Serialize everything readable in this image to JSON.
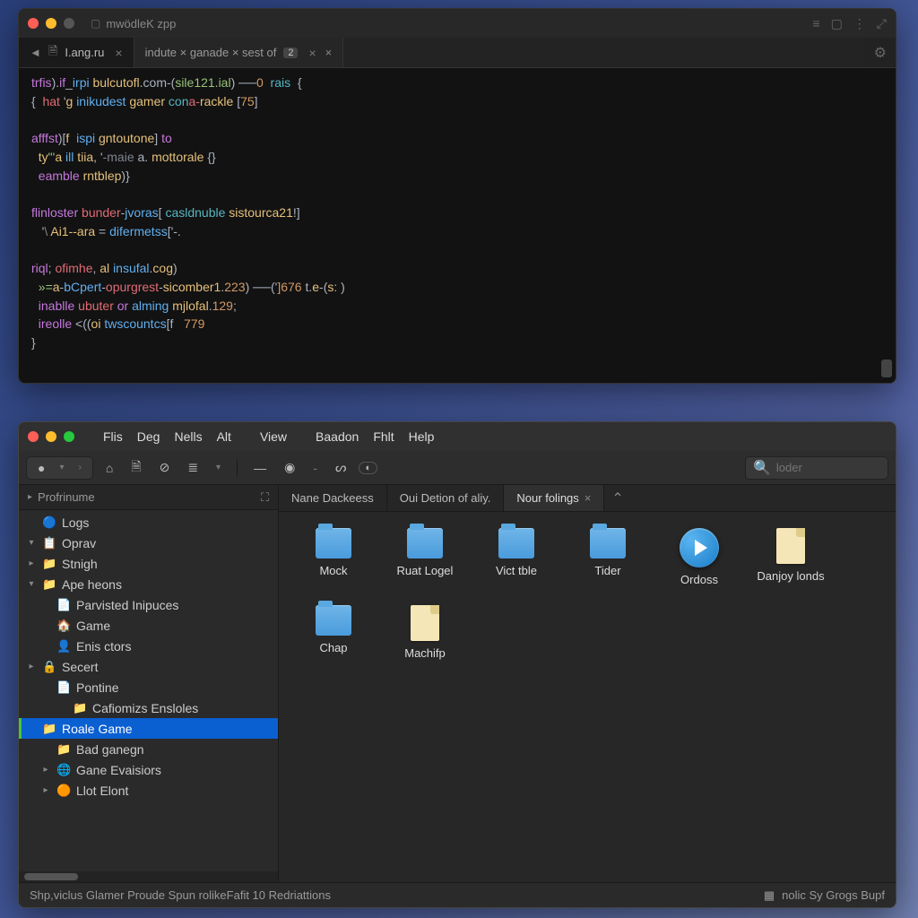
{
  "editor": {
    "title": "mwödleK zpp",
    "tabs": [
      {
        "label": "I.ang.ru",
        "active": true
      },
      {
        "label": "indute × ganade × sest of",
        "badge": "2",
        "closes": 2
      }
    ],
    "code": [
      [
        [
          "kw",
          "trfis"
        ],
        [
          "op",
          ")."
        ],
        [
          "kw",
          "if"
        ],
        [
          "op",
          "_"
        ],
        [
          "fn",
          "irpi"
        ],
        [
          "op",
          " "
        ],
        [
          "id",
          "bulcutofl"
        ],
        [
          "op",
          ".com-("
        ],
        [
          "str",
          "sile121.ial"
        ],
        [
          "op",
          ") ──"
        ],
        [
          "num",
          "0"
        ],
        [
          "op",
          "  "
        ],
        [
          "ty",
          "rais"
        ],
        [
          "op",
          "  {"
        ]
      ],
      [
        [
          "op",
          "{  "
        ],
        [
          "pr",
          "hat"
        ],
        [
          "op",
          " '"
        ],
        [
          "id",
          "g"
        ],
        [
          "op",
          " "
        ],
        [
          "fn",
          "inikudest"
        ],
        [
          "op",
          " "
        ],
        [
          "id",
          "gamer"
        ],
        [
          "op",
          " "
        ],
        [
          "ty",
          "con"
        ],
        [
          "pr",
          "a-"
        ],
        [
          "id",
          "rackle"
        ],
        [
          "op",
          " ["
        ],
        [
          "num",
          "75"
        ],
        [
          "op",
          "]"
        ]
      ],
      [],
      [
        [
          "kw",
          "afffst"
        ],
        [
          "op",
          ")["
        ],
        [
          "id",
          "f"
        ],
        [
          "op",
          "  "
        ],
        [
          "fn",
          "ispi"
        ],
        [
          "op",
          " "
        ],
        [
          "id",
          "gntoutone"
        ],
        [
          "op",
          "] "
        ],
        [
          "kw",
          "to"
        ]
      ],
      [
        [
          "op",
          "  "
        ],
        [
          "id",
          "ty"
        ],
        [
          "str",
          "\"'"
        ],
        [
          "id",
          "a"
        ],
        [
          "op",
          " "
        ],
        [
          "fn",
          "ill"
        ],
        [
          "op",
          " "
        ],
        [
          "id",
          "tiia"
        ],
        [
          "op",
          ", '"
        ],
        [
          "cm",
          "-maie"
        ],
        [
          "op",
          " a. "
        ],
        [
          "id",
          "mottorale"
        ],
        [
          "op",
          " {}"
        ]
      ],
      [
        [
          "op",
          "  "
        ],
        [
          "kw",
          "eamble"
        ],
        [
          "op",
          " "
        ],
        [
          "id",
          "rntblep"
        ],
        [
          "op",
          ")}"
        ]
      ],
      [],
      [
        [
          "kw",
          "flinloster"
        ],
        [
          "op",
          " "
        ],
        [
          "pr",
          "bunder"
        ],
        [
          "op",
          "-"
        ],
        [
          "fn",
          "jvoras"
        ],
        [
          "op",
          "[ "
        ],
        [
          "ty",
          "casldnuble"
        ],
        [
          "op",
          " "
        ],
        [
          "id",
          "sistourca21"
        ],
        [
          "op",
          "!]"
        ]
      ],
      [
        [
          "op",
          "   '"
        ],
        [
          "cm",
          "\\ "
        ],
        [
          "id",
          "Ai1--ara"
        ],
        [
          "op",
          " = "
        ],
        [
          "fn",
          "difermetss"
        ],
        [
          "op",
          "['-."
        ]
      ],
      [],
      [
        [
          "kw",
          "riql"
        ],
        [
          "op",
          "; "
        ],
        [
          "pr",
          "ofimhe"
        ],
        [
          "op",
          ", "
        ],
        [
          "id",
          "al"
        ],
        [
          "op",
          " "
        ],
        [
          "fn",
          "insufal"
        ],
        [
          "op",
          "."
        ],
        [
          "id",
          "cog"
        ],
        [
          "op",
          ")"
        ]
      ],
      [
        [
          "op",
          "  "
        ],
        [
          "str",
          "»="
        ],
        [
          "id",
          "a"
        ],
        [
          "op",
          "-"
        ],
        [
          "fn",
          "bCpert"
        ],
        [
          "op",
          "-"
        ],
        [
          "pr",
          "opurgrest"
        ],
        [
          "op",
          "-"
        ],
        [
          "id",
          "sicomber1"
        ],
        [
          "op",
          "."
        ],
        [
          "num",
          "223"
        ],
        [
          "op",
          ") ──('"
        ],
        [
          "num",
          "]676"
        ],
        [
          "op",
          " t."
        ],
        [
          "id",
          "e"
        ],
        [
          "op",
          "-("
        ],
        [
          "id",
          "s"
        ],
        [
          "op",
          ": )"
        ]
      ],
      [
        [
          "op",
          "  "
        ],
        [
          "kw",
          "inablle"
        ],
        [
          "op",
          " "
        ],
        [
          "pr",
          "ubuter"
        ],
        [
          "op",
          " "
        ],
        [
          "kw",
          "or"
        ],
        [
          "op",
          " "
        ],
        [
          "fn",
          "alming"
        ],
        [
          "op",
          " "
        ],
        [
          "id",
          "mjlofal"
        ],
        [
          "op",
          "."
        ],
        [
          "num",
          "129"
        ],
        [
          "op",
          ";"
        ]
      ],
      [
        [
          "op",
          "  "
        ],
        [
          "kw",
          "ireolle"
        ],
        [
          "op",
          " <(("
        ],
        [
          "id",
          "oi"
        ],
        [
          "op",
          " "
        ],
        [
          "fn",
          "twscountcs"
        ],
        [
          "op",
          "[f   "
        ],
        [
          "num",
          "779"
        ]
      ],
      [
        [
          "op",
          "}"
        ]
      ]
    ]
  },
  "fm": {
    "menubar": [
      "Flis",
      "Deg",
      "Nells",
      "Alt",
      "View",
      "Baadon",
      "Fhlt",
      "Help"
    ],
    "toolbar": {
      "search_placeholder": "loder"
    },
    "sidebar": {
      "header": "Profrinume",
      "tree": [
        {
          "chev": "",
          "icon": "🔵",
          "label": "Logs",
          "indent": 0,
          "cls": ""
        },
        {
          "chev": "▾",
          "icon": "📋",
          "label": "Oprav",
          "indent": 0,
          "cls": ""
        },
        {
          "chev": "▸",
          "icon": "📁",
          "label": "Stnigh",
          "indent": 0,
          "cls": ""
        },
        {
          "chev": "▾",
          "icon": "📁",
          "label": "Ape heons",
          "indent": 0,
          "cls": ""
        },
        {
          "chev": "",
          "icon": "📄",
          "label": "Parvisted Inipuces",
          "indent": 1,
          "cls": ""
        },
        {
          "chev": "",
          "icon": "🏠",
          "label": "Game",
          "indent": 1,
          "cls": ""
        },
        {
          "chev": "",
          "icon": "👤",
          "label": "Enis ctors",
          "indent": 1,
          "cls": ""
        },
        {
          "chev": "▸",
          "icon": "🔒",
          "label": "Secert",
          "indent": 0,
          "cls": ""
        },
        {
          "chev": "",
          "icon": "📄",
          "label": "Pontine",
          "indent": 1,
          "cls": ""
        },
        {
          "chev": "",
          "icon": "📁",
          "label": "Cafiomizs Ensloles",
          "indent": 2,
          "cls": "",
          "iconClass": "i-fldr"
        },
        {
          "chev": "",
          "icon": "📁",
          "label": "Roale Game",
          "indent": 2,
          "cls": "selected sel-green",
          "iconClass": "i-fldr"
        },
        {
          "chev": "",
          "icon": "📁",
          "label": "Bad ganegn",
          "indent": 1,
          "cls": "",
          "iconClass": "i-fldr"
        },
        {
          "chev": "▸",
          "icon": "🌐",
          "label": "Gane Evaisiors",
          "indent": 1,
          "cls": ""
        },
        {
          "chev": "▸",
          "icon": "🟠",
          "label": "Llot Elont",
          "indent": 1,
          "cls": ""
        }
      ]
    },
    "tabs": [
      {
        "label": "Nane Dackeess",
        "active": false
      },
      {
        "label": "Oui Detion of aliy.",
        "active": false
      },
      {
        "label": "Nour folings",
        "active": true,
        "closable": true
      }
    ],
    "items": [
      {
        "type": "folder",
        "label": "Mock"
      },
      {
        "type": "folder",
        "label": "Ruat Logel"
      },
      {
        "type": "folder",
        "label": "Vict tble"
      },
      {
        "type": "folder",
        "label": "Tider"
      },
      {
        "type": "play",
        "label": "Ordoss"
      },
      {
        "type": "doc",
        "label": "Danjoy londs"
      },
      {
        "type": "folder",
        "label": "Chap"
      },
      {
        "type": "doc",
        "label": "Machifp"
      }
    ],
    "status": {
      "left": "Shp,viclus Glamer Proude Spun rolikeFafit 10 Redriattions",
      "right": "nolic Sy Grogs Bupf"
    }
  }
}
